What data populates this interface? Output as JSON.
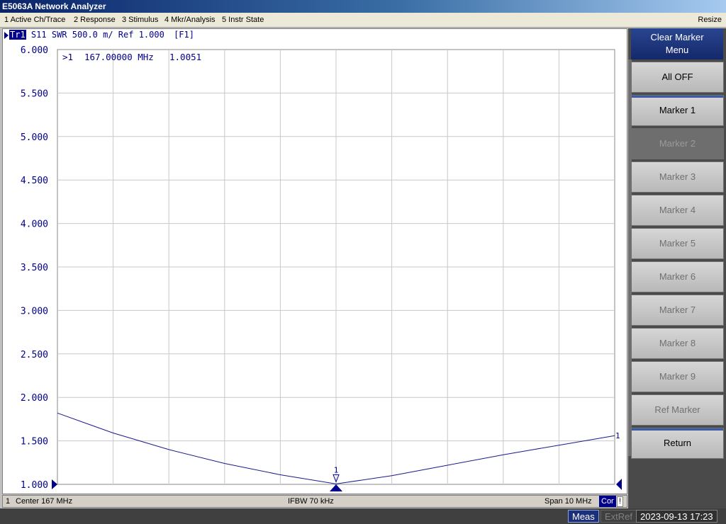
{
  "window": {
    "title": "E5063A Network Analyzer"
  },
  "menu": {
    "items": [
      "1 Active Ch/Trace",
      "2 Response",
      "3 Stimulus",
      "4 Mkr/Analysis",
      "5 Instr State"
    ],
    "resize": "Resize"
  },
  "trace": {
    "id": "Tr1",
    "param": "S11",
    "format": "SWR",
    "scale": "500.0 m/",
    "ref": "Ref 1.000",
    "tag": "[F1]"
  },
  "marker_readout": {
    "id": ">1",
    "freq": "167.00000 MHz",
    "value": "1.0051"
  },
  "chart_data": {
    "type": "line",
    "ylim": [
      1.0,
      6.0
    ],
    "yticks": [
      "6.000",
      "5.500",
      "5.000",
      "4.500",
      "4.000",
      "3.500",
      "3.000",
      "2.500",
      "2.000",
      "1.500",
      "1.000"
    ],
    "x_divisions": 10,
    "grid": true,
    "xlim_mhz": [
      162,
      172
    ],
    "trace_color": "#1a1a8c",
    "series": [
      {
        "x": [
          162,
          163,
          164,
          165,
          166,
          167,
          168,
          169,
          170,
          171,
          172
        ],
        "values": [
          1.82,
          1.59,
          1.4,
          1.24,
          1.11,
          1.005,
          1.1,
          1.22,
          1.34,
          1.45,
          1.56
        ]
      }
    ],
    "marker": {
      "label": "1",
      "x": 167,
      "value": 1.0051
    },
    "end_label": "1"
  },
  "status": {
    "channel": "1",
    "center": "Center  167 MHz",
    "ifbw": "IFBW 70 kHz",
    "span": "Span 10 MHz",
    "cor": "Cor",
    "warn": "!"
  },
  "bottom": {
    "meas": "Meas",
    "extref": "ExtRef",
    "datetime": "2023-09-13 17:23"
  },
  "softkeys": {
    "title_line1": "Clear Marker",
    "title_line2": "Menu",
    "keys": [
      {
        "label": "All OFF",
        "state": "enabled"
      },
      {
        "label": "Marker 1",
        "state": "enabled"
      },
      {
        "label": "Marker 2",
        "state": "selected"
      },
      {
        "label": "Marker 3",
        "state": "disabled"
      },
      {
        "label": "Marker 4",
        "state": "disabled"
      },
      {
        "label": "Marker 5",
        "state": "disabled"
      },
      {
        "label": "Marker 6",
        "state": "disabled"
      },
      {
        "label": "Marker 7",
        "state": "disabled"
      },
      {
        "label": "Marker 8",
        "state": "disabled"
      },
      {
        "label": "Marker 9",
        "state": "disabled"
      },
      {
        "label": "Ref Marker",
        "state": "disabled"
      },
      {
        "label": "Return",
        "state": "enabled"
      }
    ]
  }
}
